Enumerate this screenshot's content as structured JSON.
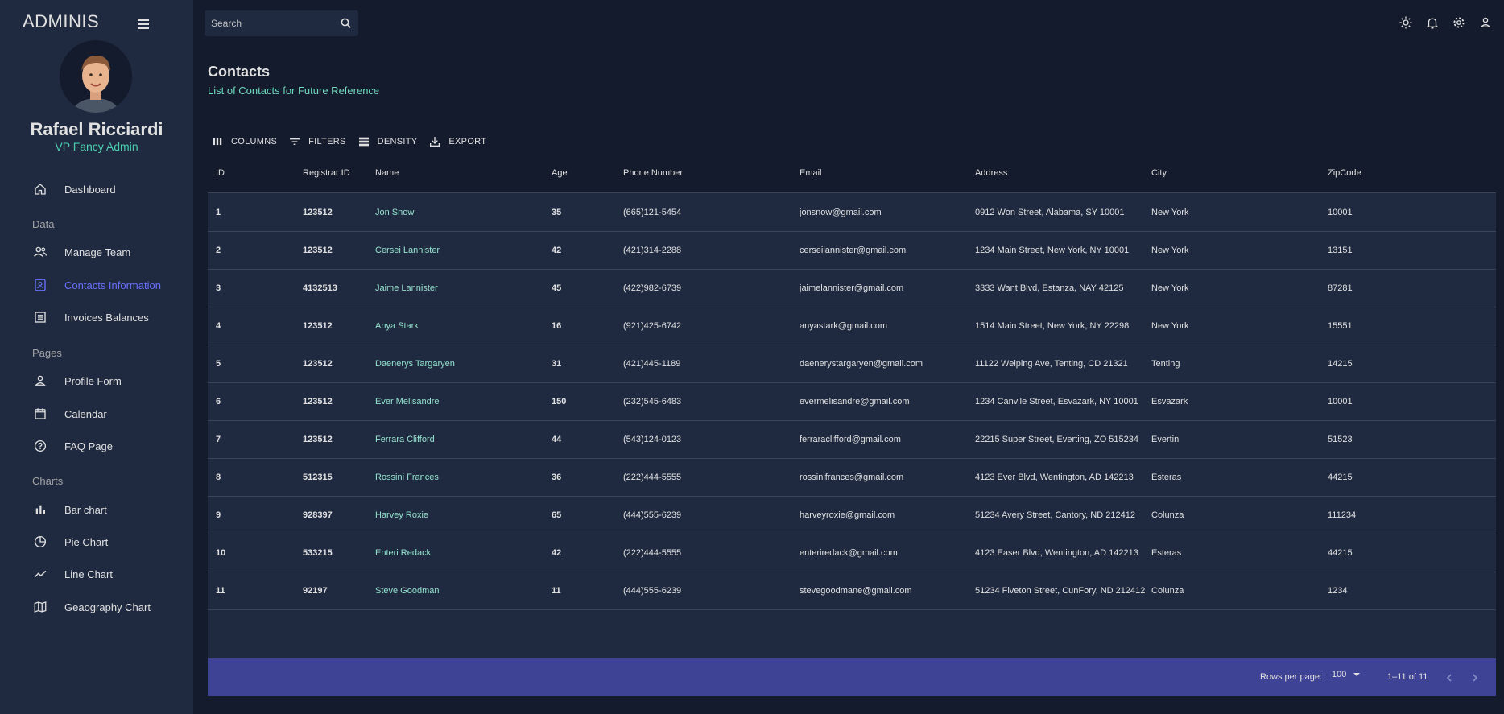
{
  "sidebar": {
    "brand": "ADMINIS",
    "profile": {
      "name": "Rafael Ricciardi",
      "role": "VP Fancy Admin"
    },
    "sections": {
      "data": "Data",
      "pages": "Pages",
      "charts": "Charts"
    },
    "items": {
      "dashboard": "Dashboard",
      "manage_team": "Manage Team",
      "contacts": "Contacts Information",
      "invoices": "Invoices Balances",
      "profile_form": "Profile Form",
      "calendar": "Calendar",
      "faq": "FAQ Page",
      "bar_chart": "Bar chart",
      "pie_chart": "Pie Chart",
      "line_chart": "Line Chart",
      "geo_chart": "Geaography Chart"
    },
    "active_item": "contacts"
  },
  "topbar": {
    "search": {
      "placeholder": "Search"
    },
    "icons": [
      "light-mode-icon",
      "notifications-icon",
      "settings-icon",
      "person-icon"
    ]
  },
  "header": {
    "title": "Contacts",
    "subtitle": "List of Contacts for Future Reference"
  },
  "toolbar": {
    "columns": "COLUMNS",
    "filters": "FILTERS",
    "density": "DENSITY",
    "export": "EXPORT"
  },
  "table": {
    "columns": [
      "ID",
      "Registrar ID",
      "Name",
      "Age",
      "Phone Number",
      "Email",
      "Address",
      "City",
      "ZipCode"
    ],
    "rows": [
      [
        "1",
        "123512",
        "Jon Snow",
        "35",
        "(665)121-5454",
        "jonsnow@gmail.com",
        "0912 Won Street, Alabama, SY 10001",
        "New York",
        "10001"
      ],
      [
        "2",
        "123512",
        "Cersei Lannister",
        "42",
        "(421)314-2288",
        "cerseilannister@gmail.com",
        "1234 Main Street, New York, NY 10001",
        "New York",
        "13151"
      ],
      [
        "3",
        "4132513",
        "Jaime Lannister",
        "45",
        "(422)982-6739",
        "jaimelannister@gmail.com",
        "3333 Want Blvd, Estanza, NAY 42125",
        "New York",
        "87281"
      ],
      [
        "4",
        "123512",
        "Anya Stark",
        "16",
        "(921)425-6742",
        "anyastark@gmail.com",
        "1514 Main Street, New York, NY 22298",
        "New York",
        "15551"
      ],
      [
        "5",
        "123512",
        "Daenerys Targaryen",
        "31",
        "(421)445-1189",
        "daenerystargaryen@gmail.com",
        "11122 Welping Ave, Tenting, CD 21321",
        "Tenting",
        "14215"
      ],
      [
        "6",
        "123512",
        "Ever Melisandre",
        "150",
        "(232)545-6483",
        "evermelisandre@gmail.com",
        "1234 Canvile Street, Esvazark, NY 10001",
        "Esvazark",
        "10001"
      ],
      [
        "7",
        "123512",
        "Ferrara Clifford",
        "44",
        "(543)124-0123",
        "ferraraclifford@gmail.com",
        "22215 Super Street, Everting, ZO 515234",
        "Evertin",
        "51523"
      ],
      [
        "8",
        "512315",
        "Rossini Frances",
        "36",
        "(222)444-5555",
        "rossinifrances@gmail.com",
        "4123 Ever Blvd, Wentington, AD 142213",
        "Esteras",
        "44215"
      ],
      [
        "9",
        "928397",
        "Harvey Roxie",
        "65",
        "(444)555-6239",
        "harveyroxie@gmail.com",
        "51234 Avery Street, Cantory, ND 212412",
        "Colunza",
        "111234"
      ],
      [
        "10",
        "533215",
        "Enteri Redack",
        "42",
        "(222)444-5555",
        "enteriredack@gmail.com",
        "4123 Easer Blvd, Wentington, AD 142213",
        "Esteras",
        "44215"
      ],
      [
        "11",
        "92197",
        "Steve Goodman",
        "11",
        "(444)555-6239",
        "stevegoodmane@gmail.com",
        "51234 Fiveton Street, CunFory, ND 212412",
        "Colunza",
        "1234"
      ]
    ]
  },
  "footer": {
    "rows_per_page_label": "Rows per page:",
    "rows_per_page_value": "100",
    "range": "1–11 of 11"
  },
  "colors": {
    "background": "#141b2d",
    "panel": "#1f2a40",
    "accent_green": "#4cceac",
    "accent_blue": "#6870fa",
    "footer": "#3e4396"
  }
}
